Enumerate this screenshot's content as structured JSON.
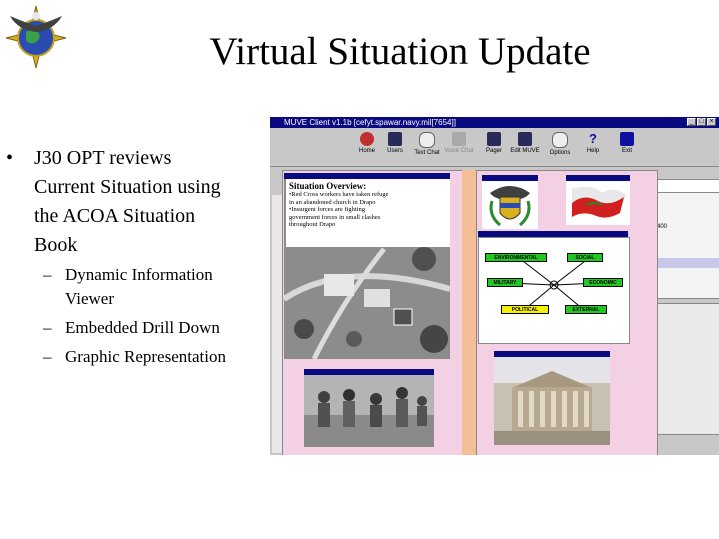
{
  "slide": {
    "title": "Virtual Situation Update",
    "bullet_main_lines": [
      "J30 OPT reviews",
      "Current Situation using",
      "the ACOA Situation",
      "Book"
    ],
    "sub_bullets": [
      [
        "Dynamic Information",
        "Viewer"
      ],
      [
        "Embedded Drill Down"
      ],
      [
        "Graphic Representation"
      ]
    ],
    "bullet_symbol": "•",
    "sub_symbol": "–"
  },
  "app": {
    "window_title": "MUVE Client v1.1b [cefyt.spawar.navy.mil[7654]]",
    "window_buttons": [
      "_",
      "□",
      "×"
    ],
    "toolbar": [
      {
        "label": "Home",
        "icon": "home-icon"
      },
      {
        "label": "Users",
        "icon": "users-icon"
      },
      {
        "label": "Text Chat",
        "icon": "text-chat-icon"
      },
      {
        "label": "Voice Chat",
        "icon": "voice-chat-icon",
        "disabled": true
      },
      {
        "label": "Pager",
        "icon": "pager-icon"
      },
      {
        "label": "Edit MUVE",
        "icon": "edit-muve-icon"
      },
      {
        "label": "Options",
        "icon": "options-icon"
      },
      {
        "label": "Help",
        "icon": "help-icon"
      },
      {
        "label": "Exit",
        "icon": "exit-icon"
      }
    ],
    "overview": {
      "title": "Situation Overview:",
      "lines": [
        "•Red Cross workers have taken refuge",
        "in an abandoned church in Drapo",
        "•Insurgent forces are fighting",
        "government forces in small clashes",
        "throughout Drapo"
      ]
    },
    "diagram_nodes": [
      "ENVIRONMENTAL",
      "SOCIAL",
      "MILITARY",
      "ECONOMIC",
      "POLITICAL",
      "EXTERNAL"
    ],
    "right_pane_value": "400"
  },
  "colors": {
    "title_bar": "#0a0a80",
    "book_page": "#f4d0e4",
    "spine": "#f4be96",
    "node_green": "#22c822",
    "node_yellow": "#f4f000"
  }
}
